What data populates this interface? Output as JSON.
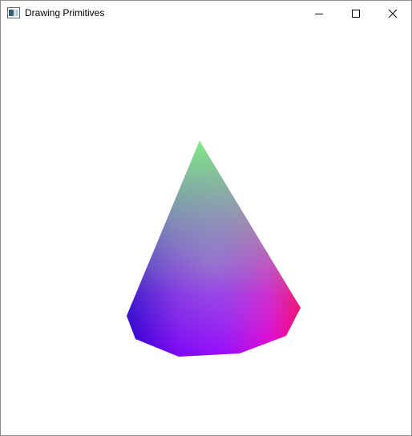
{
  "window": {
    "title": "Drawing Primitives",
    "icon": "window-app-icon",
    "controls": [
      "minimize-icon",
      "maximize-icon",
      "close-icon"
    ]
  },
  "scene": {
    "primitive": "cone",
    "background": "#ffffff",
    "colors": {
      "apex": "#80f080",
      "left": "#2a00d0",
      "bottom": "#8a00ff",
      "bottom_right": "#e600d4",
      "right": "#ff0066"
    }
  }
}
